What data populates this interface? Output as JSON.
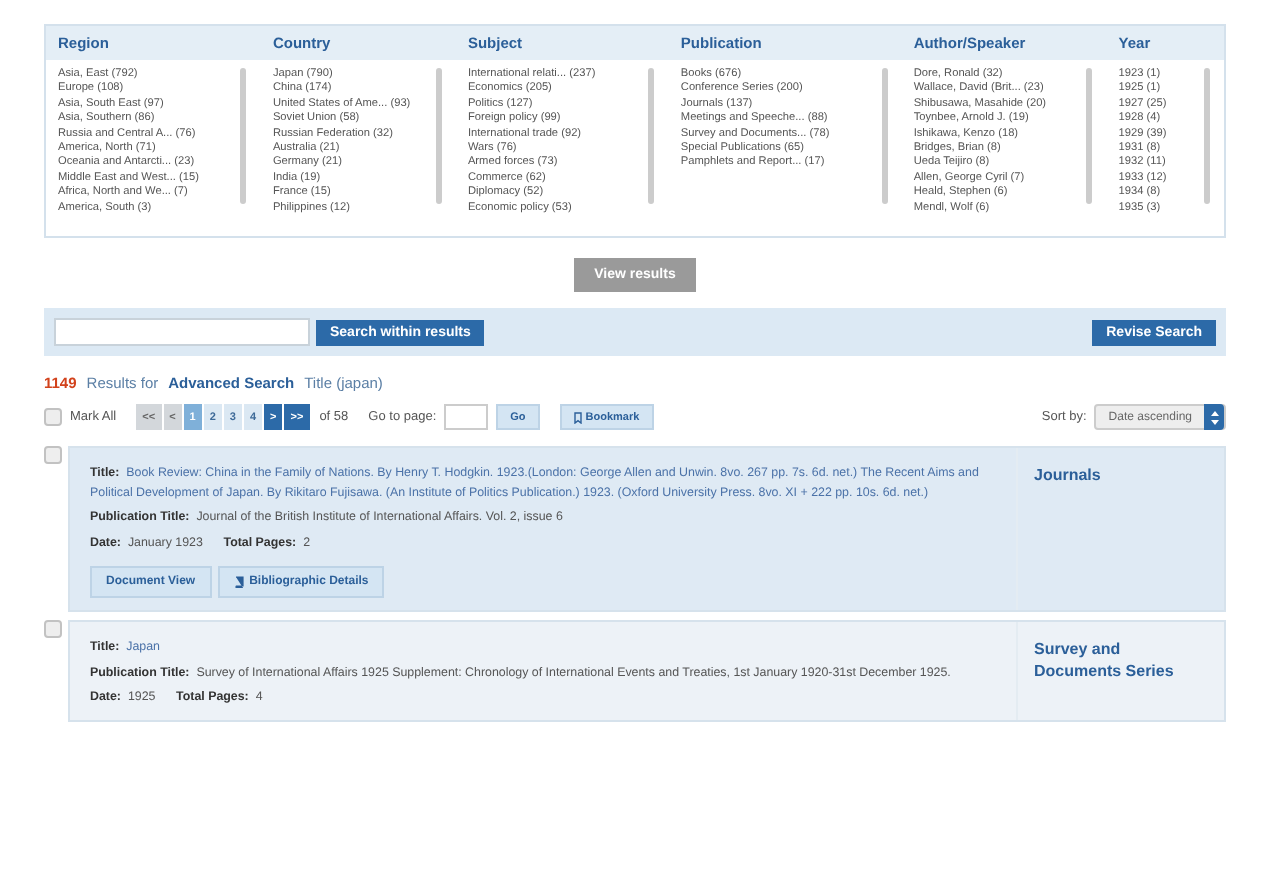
{
  "facets": [
    {
      "title": "Region",
      "items": [
        "Asia, East (792)",
        "Europe (108)",
        "Asia, South East (97)",
        "Asia, Southern (86)",
        "Russia and Central A... (76)",
        "America, North (71)",
        "Oceania and Antarcti... (23)",
        "Middle East and West... (15)",
        "Africa, North and We... (7)",
        "America, South (3)"
      ]
    },
    {
      "title": "Country",
      "items": [
        "Japan (790)",
        "China (174)",
        "United States of Ame... (93)",
        "Soviet Union (58)",
        "Russian Federation (32)",
        "Australia (21)",
        "Germany (21)",
        "India (19)",
        "France (15)",
        "Philippines (12)"
      ]
    },
    {
      "title": "Subject",
      "items": [
        "International relati... (237)",
        "Economics (205)",
        "Politics (127)",
        "Foreign policy (99)",
        "International trade (92)",
        "Wars (76)",
        "Armed forces (73)",
        "Commerce (62)",
        "Diplomacy (52)",
        "Economic policy (53)"
      ]
    },
    {
      "title": "Publication",
      "items": [
        "Books (676)",
        "Conference Series (200)",
        "Journals (137)",
        "Meetings and Speeche... (88)",
        "Survey and Documents... (78)",
        "Special Publications (65)",
        "Pamphlets and Report... (17)"
      ]
    },
    {
      "title": "Author/Speaker",
      "items": [
        "Dore, Ronald (32)",
        "Wallace, David (Brit... (23)",
        "Shibusawa, Masahide (20)",
        "Toynbee, Arnold J. (19)",
        "Ishikawa, Kenzo (18)",
        "Bridges, Brian (8)",
        "Ueda Teijiro (8)",
        "Allen, George Cyril (7)",
        "Heald, Stephen (6)",
        "Mendl, Wolf (6)"
      ]
    },
    {
      "title": "Year",
      "items": [
        "1923 (1)",
        "1925 (1)",
        "1927 (25)",
        "1928 (4)",
        "1929 (39)",
        "1931 (8)",
        "1932 (11)",
        "1933 (12)",
        "1934 (8)",
        "1935 (3)"
      ]
    }
  ],
  "view_results": {
    "label": "View results",
    "disabled": true
  },
  "search_within": {
    "button": "Search within results"
  },
  "revise_search": "Revise Search",
  "summary": {
    "count": "1149",
    "results_for": "Results for",
    "search_type": "Advanced Search",
    "query": "Title (japan)"
  },
  "toolbar": {
    "mark_all": {
      "label": "Mark All",
      "checked": false
    },
    "pages": [
      {
        "label": "<<",
        "disabled": true,
        "selected": false
      },
      {
        "label": "<",
        "disabled": true,
        "selected": false
      },
      {
        "label": "1",
        "disabled": false,
        "selected": true
      },
      {
        "label": "2",
        "disabled": false,
        "selected": false
      },
      {
        "label": "3",
        "disabled": false,
        "selected": false
      },
      {
        "label": "4",
        "disabled": false,
        "selected": false
      },
      {
        "label": ">",
        "disabled": false,
        "selected": false
      },
      {
        "label": ">>",
        "disabled": false,
        "selected": false
      }
    ],
    "of_pages": "of 58",
    "go_to_page": "Go to page:",
    "go": "Go",
    "bookmark": "Bookmark",
    "sort_label": "Sort by:",
    "sort_value": "Date ascending"
  },
  "results": [
    {
      "highlighted": true,
      "checked": false,
      "title_label": "Title:",
      "title": "Book Review: China in the Family of Nations. By Henry T. Hodgkin. 1923.(London: George Allen and Unwin. 8vo. 267 pp. 7s. 6d. net.) The Recent Aims and Political Development of Japan. By Rikitaro Fujisawa. (An Institute of Politics Publication.) 1923. (Oxford University Press. 8vo. XI + 222 pp. 10s. 6d. net.)",
      "pub_label": "Publication Title:",
      "pub": "Journal of the British Institute of International Affairs. Vol. 2, issue 6",
      "date_label": "Date:",
      "date": "January 1923",
      "pages_label": "Total Pages:",
      "pages": "2",
      "type": "Journals",
      "buttons": [
        "Document View",
        "Bibliographic Details"
      ]
    },
    {
      "highlighted": false,
      "checked": false,
      "title_label": "Title:",
      "title": "Japan",
      "pub_label": "Publication Title:",
      "pub": "Survey of International Affairs 1925 Supplement: Chronology of International Events and Treaties, 1st January 1920-31st December 1925.",
      "date_label": "Date:",
      "date": "1925",
      "pages_label": "Total Pages:",
      "pages": "4",
      "type": "Survey and Documents Series"
    }
  ]
}
